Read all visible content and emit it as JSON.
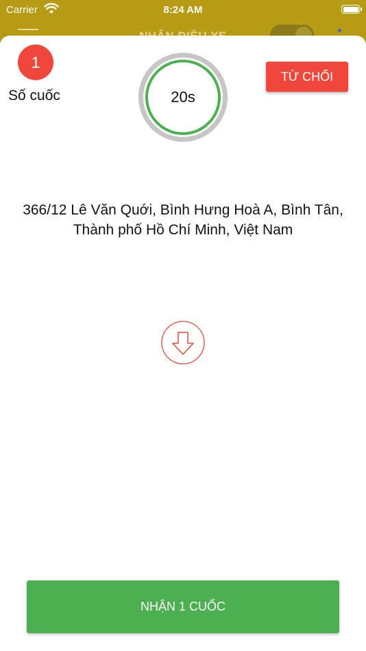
{
  "status_bar": {
    "carrier": "Carrier",
    "time": "8:24 AM"
  },
  "background_header": {
    "title": "NHẬN ĐIỀU XE"
  },
  "popup": {
    "ride_count": "1",
    "ride_count_label": "Số cuốc",
    "timer_text": "20s",
    "reject_label": "TỪ CHỐI",
    "address_line1": "366/12 Lê Văn Quới, Bình Hưng Hoà A, Bình Tân,",
    "address_line2": "Thành phố Hồ Chí Minh, Việt Nam",
    "accept_label": "NHẬN 1 CUỐC"
  },
  "icons": {
    "wifi": "wifi-icon",
    "battery": "battery-icon",
    "menu": "hamburger-icon",
    "arrow": "arrow-down-circle-icon"
  },
  "colors": {
    "header_bg": "#b89b14",
    "accent_red": "#f0473d",
    "accent_green": "#4caf50"
  }
}
